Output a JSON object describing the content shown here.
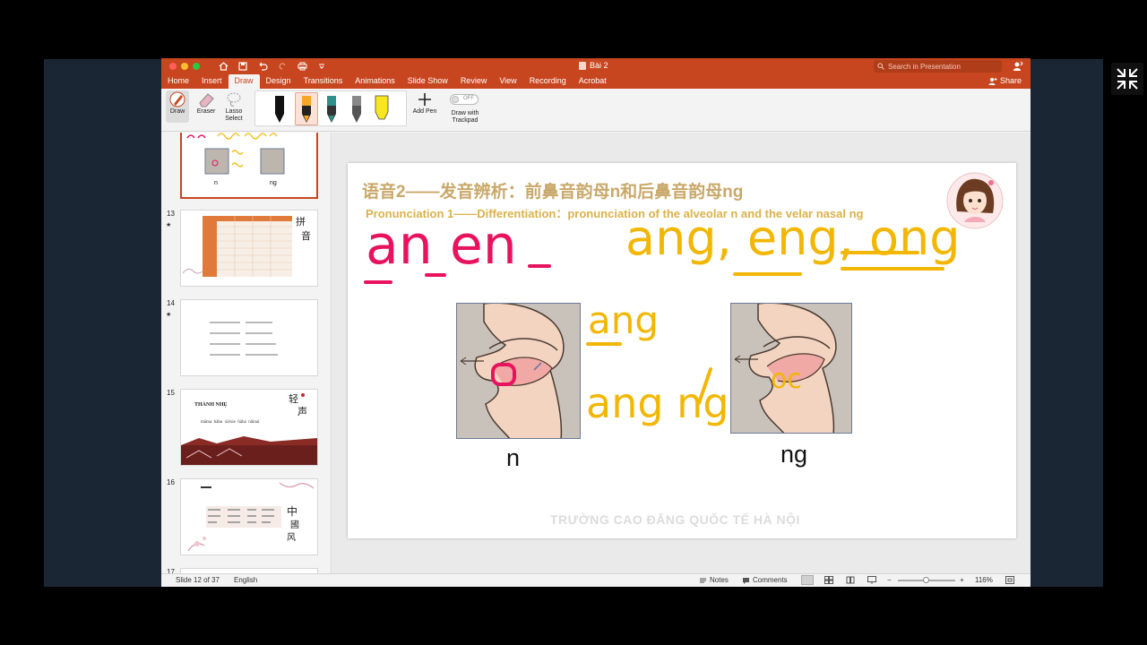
{
  "window": {
    "document_title": "Bài 2",
    "search_placeholder": "Search in Presentation",
    "traffic_lights": [
      "#ff5f57",
      "#febc2e",
      "#28c840"
    ]
  },
  "tabs": [
    "Home",
    "Insert",
    "Draw",
    "Design",
    "Transitions",
    "Animations",
    "Slide Show",
    "Review",
    "View",
    "Recording",
    "Acrobat"
  ],
  "active_tab": "Draw",
  "share_label": "Share",
  "draw_ribbon": {
    "draw_label": "Draw",
    "eraser_label": "Eraser",
    "lasso_label": "Lasso\nSelect",
    "add_pen_label": "Add Pen",
    "toggle_state": "OFF",
    "draw_with_trackpad_label": "Draw with\nTrackpad",
    "pen_colors": [
      "#111111",
      "#f5a623",
      "#2f8f8a",
      "#555555",
      "#f7e620"
    ]
  },
  "thumbnails": [
    {
      "number": "",
      "starred": false,
      "selected": true
    },
    {
      "number": "13",
      "starred": true,
      "selected": false
    },
    {
      "number": "14",
      "starred": true,
      "selected": false
    },
    {
      "number": "15",
      "starred": false,
      "selected": false,
      "title": "THANH NHẸ",
      "words": "māma  bàba  xièxie  bàba  nǎinai"
    },
    {
      "number": "16",
      "starred": false,
      "selected": false
    },
    {
      "number": "17",
      "starred": false,
      "selected": false
    }
  ],
  "slide": {
    "title_cn": "语音2——发音辨析：前鼻音韵母n和后鼻音韵母ng",
    "title_en": "Pronunciation 1——Differentiation：pronunciation of the alveolar n and the velar nasal ng",
    "caption_left": "n",
    "caption_right": "ng",
    "watermark": "TRƯỜNG CAO ĐẲNG QUỐC TẾ HÀ NỘI",
    "ink": {
      "pink_words": "an  en",
      "yellow_words": "ang, eng, ong",
      "yellow_mid_1": "ang",
      "yellow_mid_2": "ang ng",
      "pink_mark": "o",
      "yellow_mark": "oc"
    },
    "ink_colors": {
      "pink": "#e8135f",
      "yellow": "#f2b705"
    }
  },
  "status": {
    "slide_position": "Slide 12 of 37",
    "language": "English",
    "notes_label": "Notes",
    "comments_label": "Comments",
    "zoom": "116%"
  }
}
